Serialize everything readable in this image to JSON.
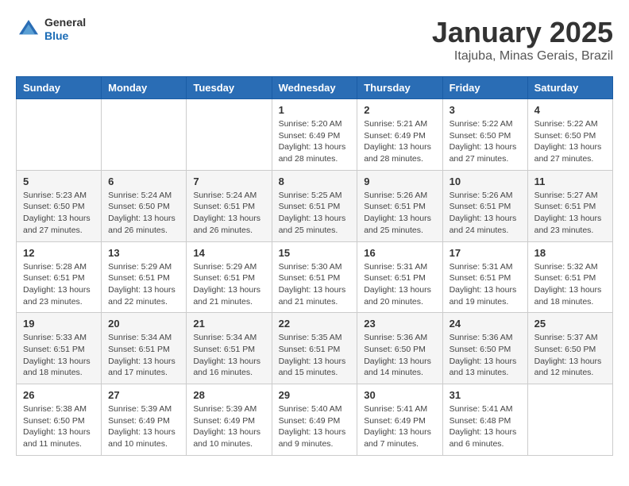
{
  "header": {
    "logo_general": "General",
    "logo_blue": "Blue",
    "month_title": "January 2025",
    "location": "Itajuba, Minas Gerais, Brazil"
  },
  "weekdays": [
    "Sunday",
    "Monday",
    "Tuesday",
    "Wednesday",
    "Thursday",
    "Friday",
    "Saturday"
  ],
  "weeks": [
    [
      {
        "day": "",
        "info": ""
      },
      {
        "day": "",
        "info": ""
      },
      {
        "day": "",
        "info": ""
      },
      {
        "day": "1",
        "info": "Sunrise: 5:20 AM\nSunset: 6:49 PM\nDaylight: 13 hours and 28 minutes."
      },
      {
        "day": "2",
        "info": "Sunrise: 5:21 AM\nSunset: 6:49 PM\nDaylight: 13 hours and 28 minutes."
      },
      {
        "day": "3",
        "info": "Sunrise: 5:22 AM\nSunset: 6:50 PM\nDaylight: 13 hours and 27 minutes."
      },
      {
        "day": "4",
        "info": "Sunrise: 5:22 AM\nSunset: 6:50 PM\nDaylight: 13 hours and 27 minutes."
      }
    ],
    [
      {
        "day": "5",
        "info": "Sunrise: 5:23 AM\nSunset: 6:50 PM\nDaylight: 13 hours and 27 minutes."
      },
      {
        "day": "6",
        "info": "Sunrise: 5:24 AM\nSunset: 6:50 PM\nDaylight: 13 hours and 26 minutes."
      },
      {
        "day": "7",
        "info": "Sunrise: 5:24 AM\nSunset: 6:51 PM\nDaylight: 13 hours and 26 minutes."
      },
      {
        "day": "8",
        "info": "Sunrise: 5:25 AM\nSunset: 6:51 PM\nDaylight: 13 hours and 25 minutes."
      },
      {
        "day": "9",
        "info": "Sunrise: 5:26 AM\nSunset: 6:51 PM\nDaylight: 13 hours and 25 minutes."
      },
      {
        "day": "10",
        "info": "Sunrise: 5:26 AM\nSunset: 6:51 PM\nDaylight: 13 hours and 24 minutes."
      },
      {
        "day": "11",
        "info": "Sunrise: 5:27 AM\nSunset: 6:51 PM\nDaylight: 13 hours and 23 minutes."
      }
    ],
    [
      {
        "day": "12",
        "info": "Sunrise: 5:28 AM\nSunset: 6:51 PM\nDaylight: 13 hours and 23 minutes."
      },
      {
        "day": "13",
        "info": "Sunrise: 5:29 AM\nSunset: 6:51 PM\nDaylight: 13 hours and 22 minutes."
      },
      {
        "day": "14",
        "info": "Sunrise: 5:29 AM\nSunset: 6:51 PM\nDaylight: 13 hours and 21 minutes."
      },
      {
        "day": "15",
        "info": "Sunrise: 5:30 AM\nSunset: 6:51 PM\nDaylight: 13 hours and 21 minutes."
      },
      {
        "day": "16",
        "info": "Sunrise: 5:31 AM\nSunset: 6:51 PM\nDaylight: 13 hours and 20 minutes."
      },
      {
        "day": "17",
        "info": "Sunrise: 5:31 AM\nSunset: 6:51 PM\nDaylight: 13 hours and 19 minutes."
      },
      {
        "day": "18",
        "info": "Sunrise: 5:32 AM\nSunset: 6:51 PM\nDaylight: 13 hours and 18 minutes."
      }
    ],
    [
      {
        "day": "19",
        "info": "Sunrise: 5:33 AM\nSunset: 6:51 PM\nDaylight: 13 hours and 18 minutes."
      },
      {
        "day": "20",
        "info": "Sunrise: 5:34 AM\nSunset: 6:51 PM\nDaylight: 13 hours and 17 minutes."
      },
      {
        "day": "21",
        "info": "Sunrise: 5:34 AM\nSunset: 6:51 PM\nDaylight: 13 hours and 16 minutes."
      },
      {
        "day": "22",
        "info": "Sunrise: 5:35 AM\nSunset: 6:51 PM\nDaylight: 13 hours and 15 minutes."
      },
      {
        "day": "23",
        "info": "Sunrise: 5:36 AM\nSunset: 6:50 PM\nDaylight: 13 hours and 14 minutes."
      },
      {
        "day": "24",
        "info": "Sunrise: 5:36 AM\nSunset: 6:50 PM\nDaylight: 13 hours and 13 minutes."
      },
      {
        "day": "25",
        "info": "Sunrise: 5:37 AM\nSunset: 6:50 PM\nDaylight: 13 hours and 12 minutes."
      }
    ],
    [
      {
        "day": "26",
        "info": "Sunrise: 5:38 AM\nSunset: 6:50 PM\nDaylight: 13 hours and 11 minutes."
      },
      {
        "day": "27",
        "info": "Sunrise: 5:39 AM\nSunset: 6:49 PM\nDaylight: 13 hours and 10 minutes."
      },
      {
        "day": "28",
        "info": "Sunrise: 5:39 AM\nSunset: 6:49 PM\nDaylight: 13 hours and 10 minutes."
      },
      {
        "day": "29",
        "info": "Sunrise: 5:40 AM\nSunset: 6:49 PM\nDaylight: 13 hours and 9 minutes."
      },
      {
        "day": "30",
        "info": "Sunrise: 5:41 AM\nSunset: 6:49 PM\nDaylight: 13 hours and 7 minutes."
      },
      {
        "day": "31",
        "info": "Sunrise: 5:41 AM\nSunset: 6:48 PM\nDaylight: 13 hours and 6 minutes."
      },
      {
        "day": "",
        "info": ""
      }
    ]
  ]
}
